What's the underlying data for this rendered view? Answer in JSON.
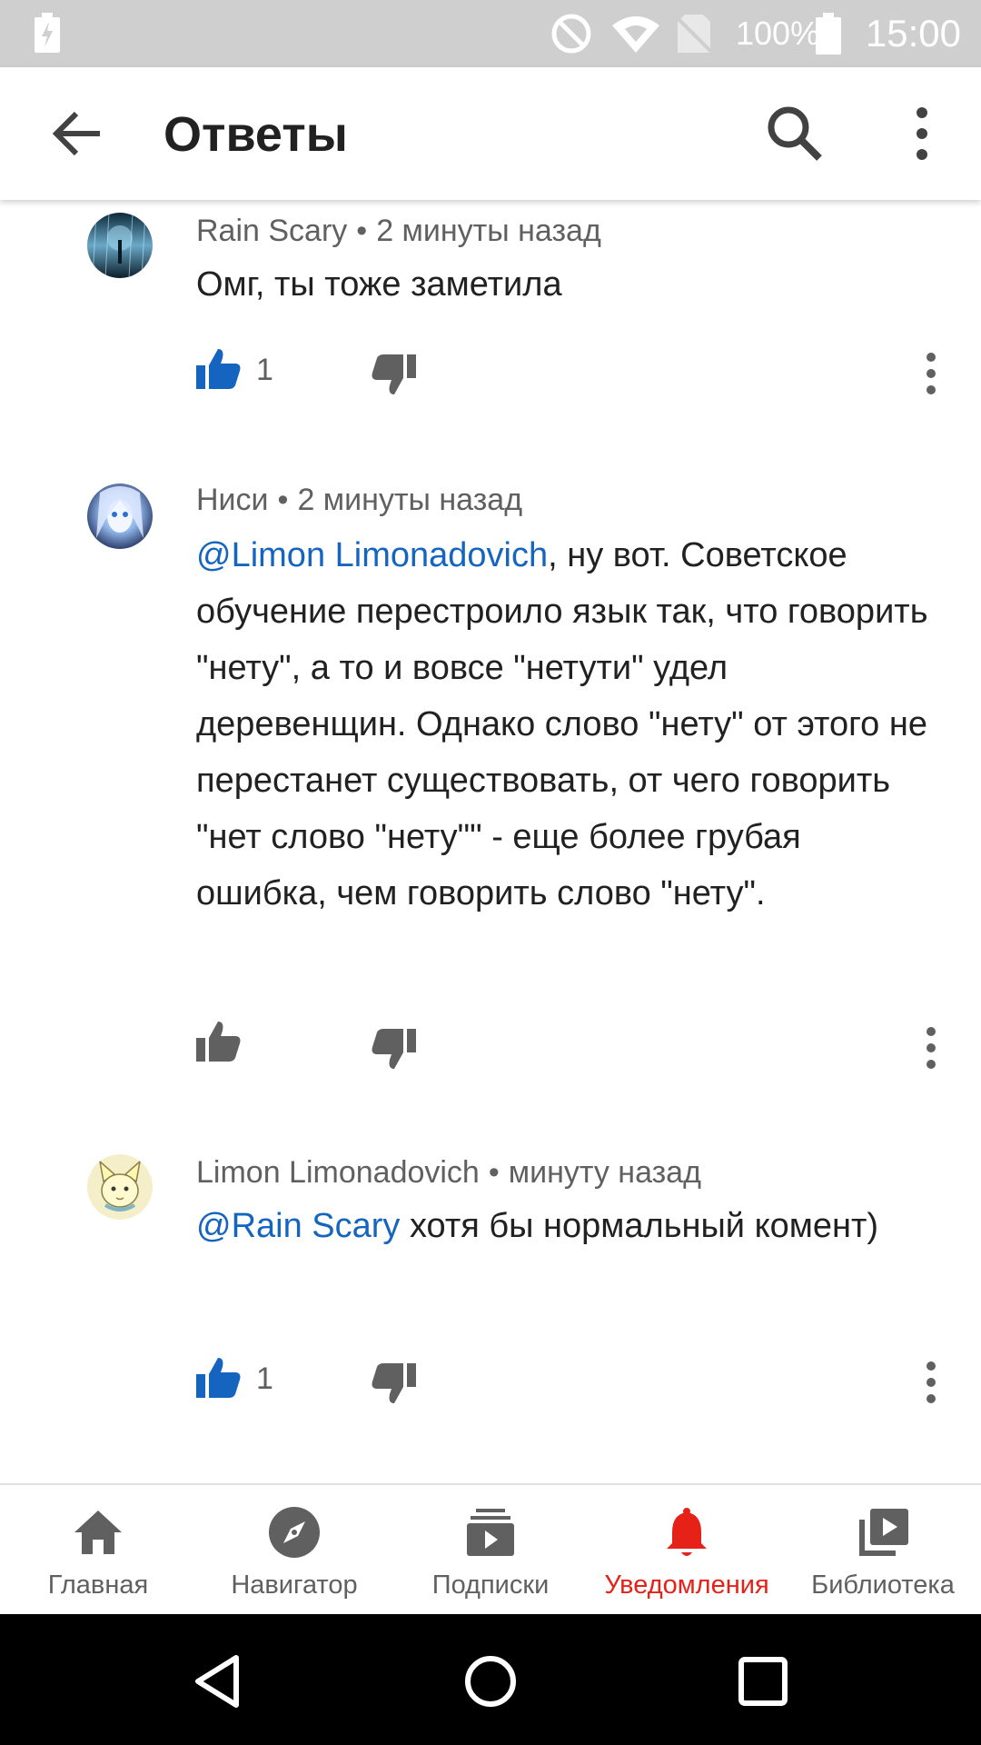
{
  "status_bar": {
    "battery_percent": "100%",
    "time": "15:00",
    "icons": [
      "battery-charging-icon",
      "do-not-disturb-icon",
      "wifi-icon",
      "no-sim-icon",
      "battery-icon"
    ]
  },
  "app_bar": {
    "title": "Ответы",
    "icons": [
      "back-arrow-icon",
      "search-icon",
      "more-vert-icon"
    ]
  },
  "comments": [
    {
      "author": "Rain Scary",
      "separator": "•",
      "time": "2 минуты назад",
      "mention": "",
      "text": "Омг, ты тоже заметила",
      "likes": "1",
      "liked": true
    },
    {
      "author": "Ниси",
      "separator": "•",
      "time": "2 минуты назад",
      "mention": "@Limon Limonadovich",
      "text": ", ну вот. Советское обучение перестроило язык так, что говорить \"нету\", а то и вовсе \"нетути\" удел деревенщин. Однако слово \"нету\" от этого не перестанет существовать, от чего говорить \"нет слово \"нету\"\" - еще более грубая ошибка, чем говорить слово \"нету\".",
      "likes": "",
      "liked": false
    },
    {
      "author": "Limon Limonadovich",
      "separator": "•",
      "time": "минуту назад",
      "mention": "@Rain Scary",
      "text": " хотя бы нормальный комент)",
      "likes": "1",
      "liked": true
    }
  ],
  "bottom_nav": {
    "items": [
      {
        "label": "Главная",
        "icon": "home-icon",
        "active": false
      },
      {
        "label": "Навигатор",
        "icon": "explore-icon",
        "active": false
      },
      {
        "label": "Подписки",
        "icon": "subscriptions-icon",
        "active": false
      },
      {
        "label": "Уведомления",
        "icon": "notifications-icon",
        "active": true
      },
      {
        "label": "Библиотека",
        "icon": "library-icon",
        "active": false
      }
    ]
  },
  "colors": {
    "accent": "#e62117",
    "mention": "#1565c0",
    "like_active": "#1565c0",
    "icon_gray": "#606060"
  }
}
